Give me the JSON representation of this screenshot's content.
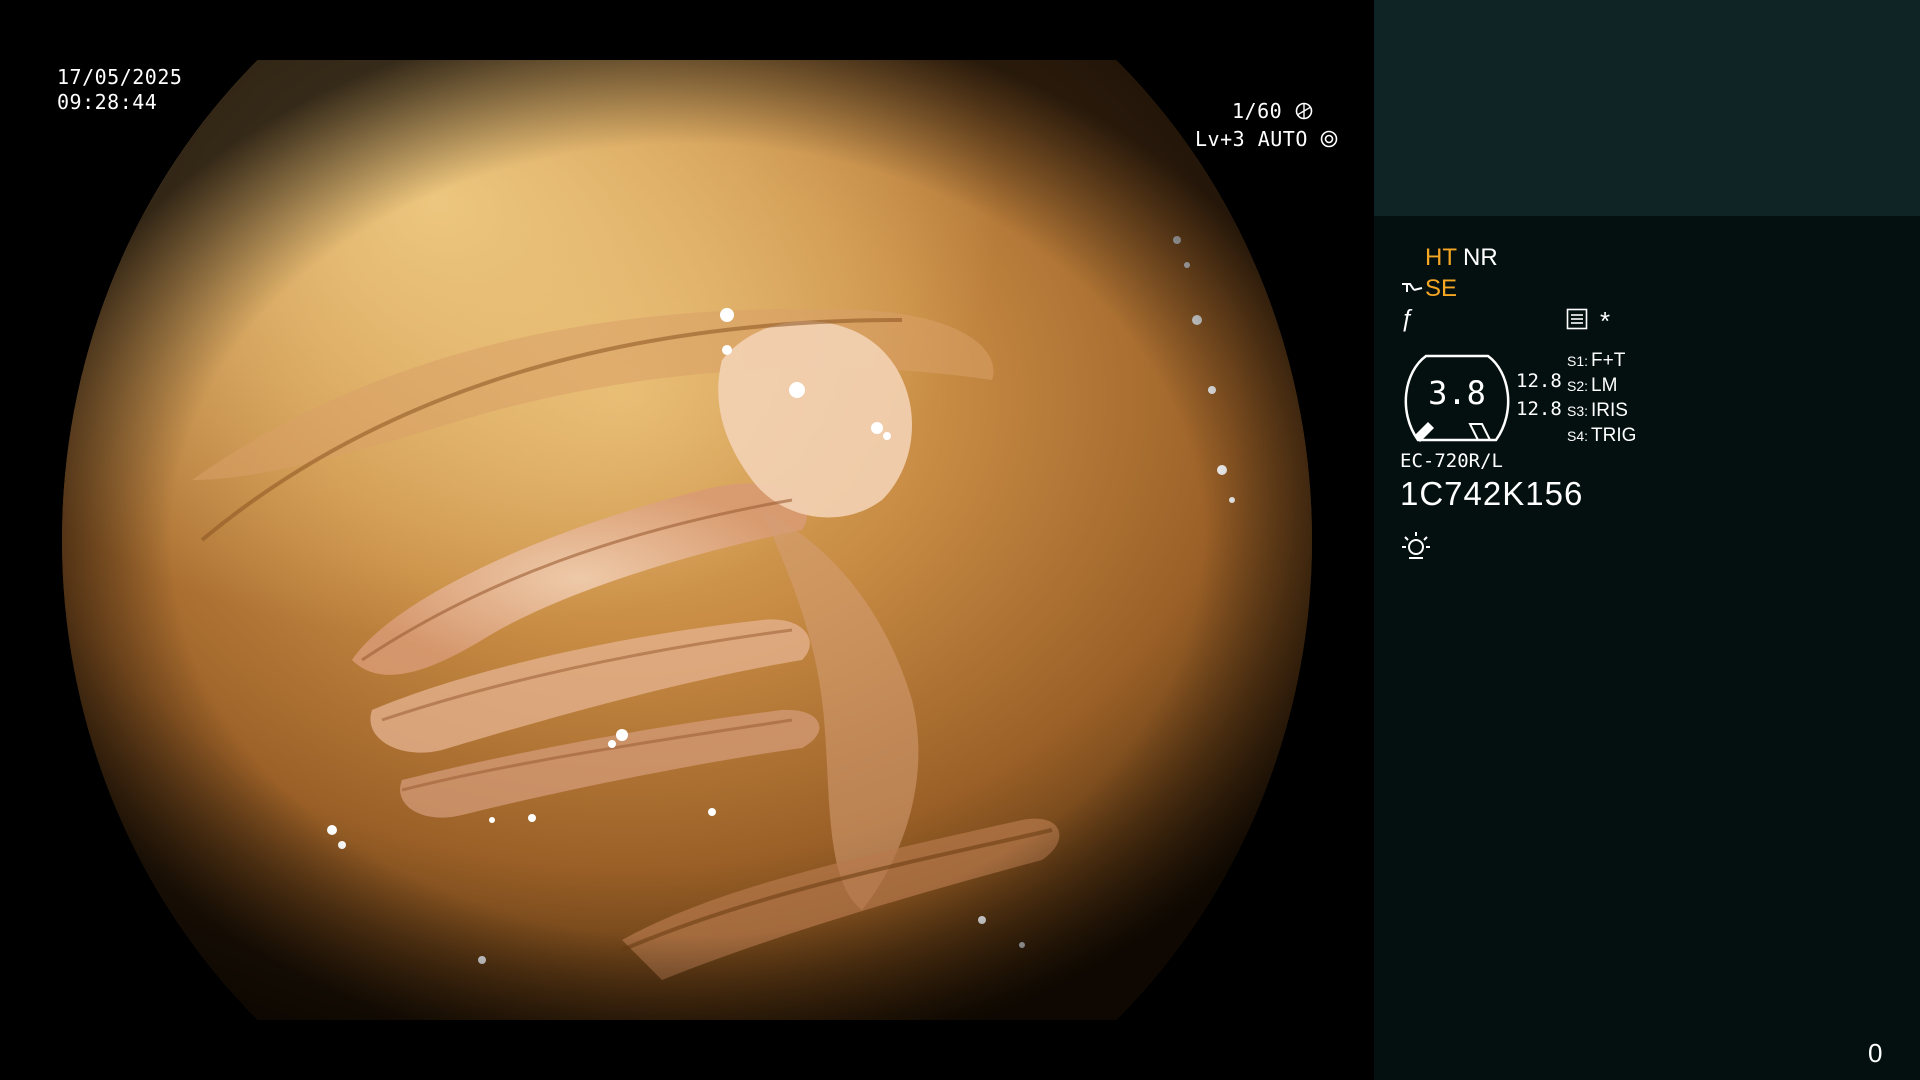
{
  "overlay": {
    "date": "17/05/2025",
    "time": "09:28:44",
    "shutter": "1/60",
    "level": "Lv+3",
    "mode": "AUTO"
  },
  "panel": {
    "ht": "HT",
    "nr": "NR",
    "se": "SE",
    "f_symbol": "ƒ",
    "star": "*",
    "gauge_value": "3.8",
    "value_1": "12.8",
    "value_2": "12.8",
    "switches": [
      {
        "key": "S1:",
        "value": "F+T"
      },
      {
        "key": "S2:",
        "value": "LM"
      },
      {
        "key": "S3:",
        "value": "IRIS"
      },
      {
        "key": "S4:",
        "value": "TRIG"
      }
    ],
    "model": "EC-720R/L",
    "serial": "1C742K156",
    "counter": "0"
  },
  "colors": {
    "accent_orange": "#f5a623",
    "panel_top": "#0f2424",
    "panel_bottom": "#041010"
  },
  "icons": [
    "shutter-icon",
    "auto-iris-icon",
    "se-probe-icon",
    "menu-icon",
    "light-icon"
  ]
}
